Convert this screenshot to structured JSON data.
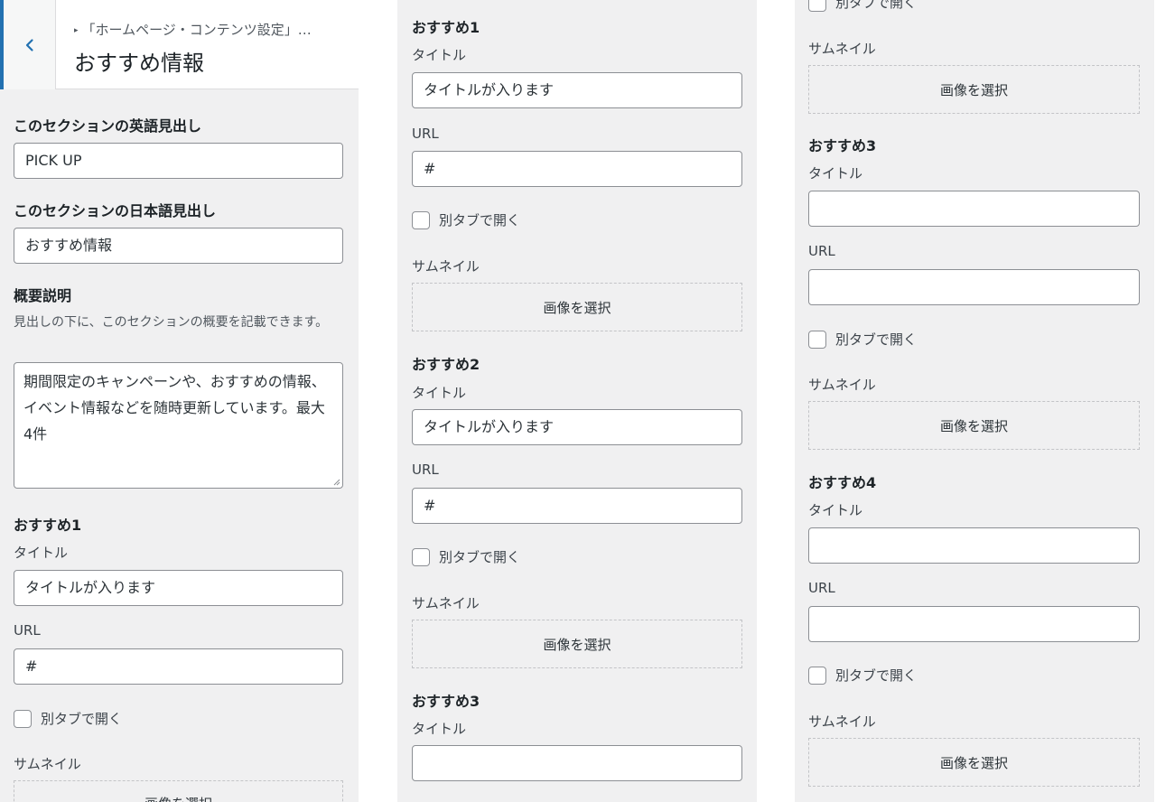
{
  "panel1": {
    "breadcrumb": "「ホームページ・コンテンツ設定」…",
    "title": "おすすめ情報",
    "en_heading_label": "このセクションの英語見出し",
    "en_heading_value": "PICK UP",
    "ja_heading_label": "このセクションの日本語見出し",
    "ja_heading_value": "おすすめ情報",
    "summary_label": "概要説明",
    "summary_help": "見出しの下に、このセクションの概要を記載できます。",
    "summary_value": "期間限定のキャンペーンや、おすすめの情報、イベント情報などを随時更新しています。最大4件",
    "item1_heading": "おすすめ1",
    "title_label": "タイトル",
    "item1_title": "タイトルが入ります",
    "url_label": "URL",
    "item1_url": "#",
    "new_tab_label": "別タブで開く",
    "thumbnail_label": "サムネイル",
    "select_image": "画像を選択"
  },
  "panel2": {
    "item1_heading": "おすすめ1",
    "title_label": "タイトル",
    "item1_title": "タイトルが入ります",
    "url_label": "URL",
    "item1_url": "#",
    "new_tab_label": "別タブで開く",
    "thumbnail_label": "サムネイル",
    "select_image": "画像を選択",
    "item2_heading": "おすすめ2",
    "item2_title": "タイトルが入ります",
    "item2_url": "#",
    "item3_heading": "おすすめ3"
  },
  "panel3": {
    "new_tab_label": "別タブで開く",
    "thumbnail_label": "サムネイル",
    "select_image": "画像を選択",
    "item3_heading": "おすすめ3",
    "title_label": "タイトル",
    "url_label": "URL",
    "item3_title": "",
    "item3_url": "",
    "item4_heading": "おすすめ4",
    "item4_title": "",
    "item4_url": ""
  },
  "icons": {
    "back": "chevron-left-icon",
    "breadcrumb": "triangle-right-icon",
    "resize": "resize-grip-icon"
  },
  "colors": {
    "accent": "#2271b1",
    "panel_bg": "#f0f0f1",
    "input_border": "#8c8f94"
  }
}
